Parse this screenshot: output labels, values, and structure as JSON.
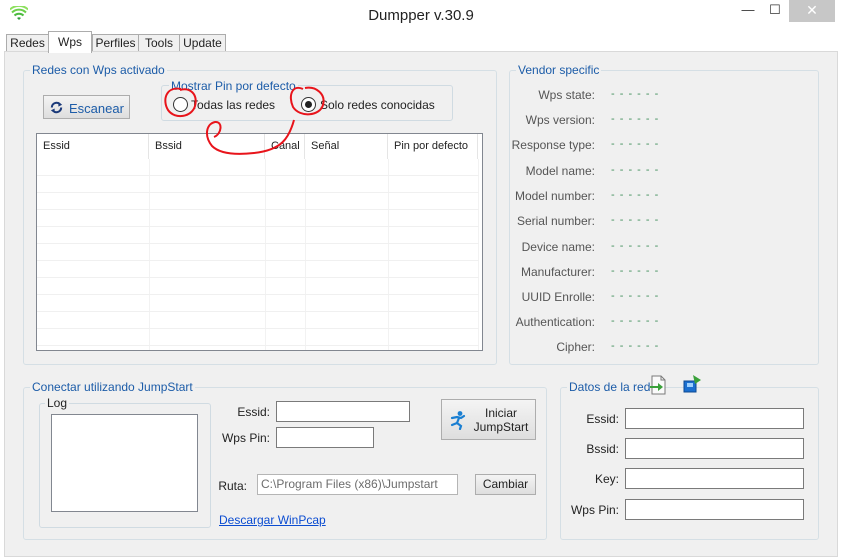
{
  "window": {
    "title": "Dumpper v.30.9",
    "minimize_glyph": "—",
    "maximize_glyph": "☐",
    "close_glyph": "✕"
  },
  "tabs": [
    {
      "label": "Redes",
      "active": false
    },
    {
      "label": "Wps",
      "active": true
    },
    {
      "label": "Perfiles",
      "active": false
    },
    {
      "label": "Tools",
      "active": false
    },
    {
      "label": "Update",
      "active": false
    }
  ],
  "wps_group": {
    "title": "Redes con Wps activado",
    "scan_button": "Escanear",
    "pin_group": {
      "title": "Mostrar Pin por defecto",
      "options": [
        {
          "label": "Todas las redes",
          "selected": false
        },
        {
          "label": "Solo redes conocidas",
          "selected": true
        }
      ]
    },
    "columns": [
      "Essid",
      "Bssid",
      "Canal",
      "Señal",
      "Pin por defecto"
    ]
  },
  "vendor": {
    "title": "Vendor specific",
    "fields": [
      {
        "label": "Wps state:",
        "value": "- - - - - -"
      },
      {
        "label": "Wps version:",
        "value": "- - - - - -"
      },
      {
        "label": "Response type:",
        "value": "- - - - - -"
      },
      {
        "label": "Model name:",
        "value": "- - - - - -"
      },
      {
        "label": "Model number:",
        "value": "- - - - - -"
      },
      {
        "label": "Serial number:",
        "value": "- - - - - -"
      },
      {
        "label": "Device name:",
        "value": "- - - - - -"
      },
      {
        "label": "Manufacturer:",
        "value": "- - - - - -"
      },
      {
        "label": "UUID Enrolle:",
        "value": "- - - - - -"
      },
      {
        "label": "Authentication:",
        "value": "- - - - - -"
      },
      {
        "label": "Cipher:",
        "value": "- - - - - -"
      }
    ]
  },
  "jumpstart": {
    "title": "Conectar utilizando JumpStart",
    "log_title": "Log",
    "essid_label": "Essid:",
    "essid_value": "",
    "wps_pin_label": "Wps Pin:",
    "wps_pin_value": "",
    "start_button_line1": "Iniciar",
    "start_button_line2": "JumpStart",
    "path_label": "Ruta:",
    "path_value": "C:\\Program Files (x86)\\Jumpstart",
    "change_button": "Cambiar",
    "download_link": "Descargar WinPcap"
  },
  "network_data": {
    "title": "Datos de la red",
    "fields": [
      {
        "label": "Essid:",
        "value": ""
      },
      {
        "label": "Bssid:",
        "value": ""
      },
      {
        "label": "Key:",
        "value": ""
      },
      {
        "label": "Wps Pin:",
        "value": ""
      }
    ]
  },
  "colors": {
    "group_title": "#1c5ca8",
    "annotation": "#e8141b",
    "dash_value": "#3e8e5a"
  }
}
